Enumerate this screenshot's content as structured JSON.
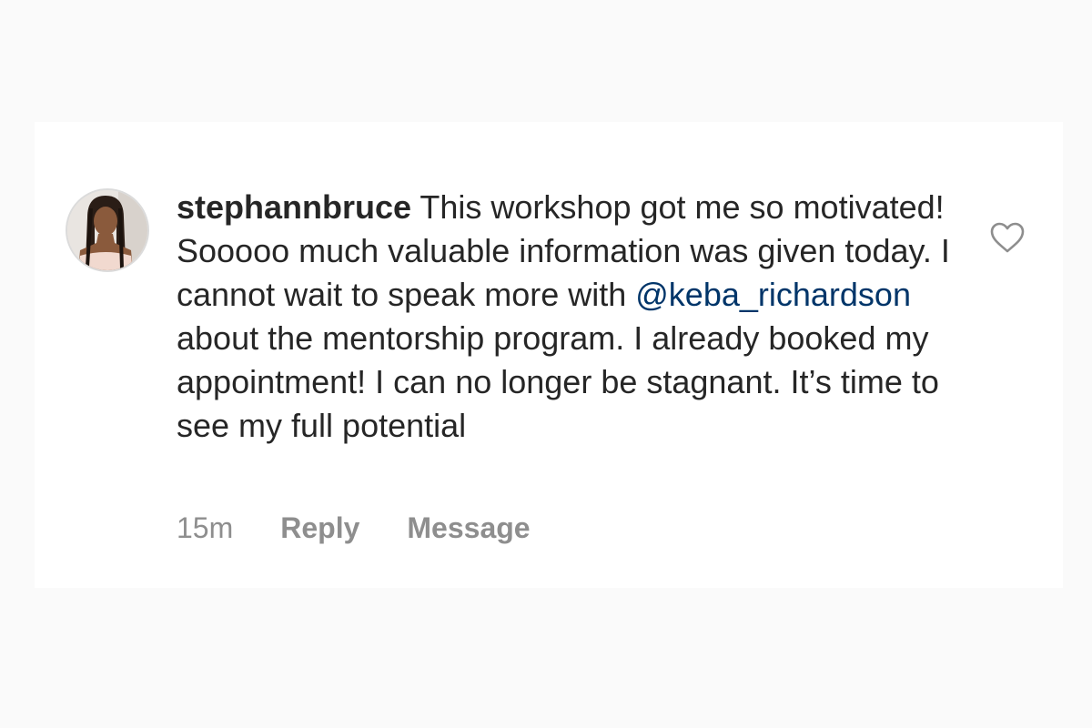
{
  "comment": {
    "username": "stephannbruce",
    "text_before_mention": " This workshop got me so motivated! Sooooo much valuable information was given today. I cannot wait to speak more with ",
    "mention": "@keba_richardson",
    "text_after_mention": " about the mentorship program. I already booked my appointment! I can no longer be stagnant. It’s time to see my full potential"
  },
  "meta": {
    "timestamp": "15m",
    "reply_label": "Reply",
    "message_label": "Message"
  },
  "icons": {
    "like": "heart-outline-icon",
    "avatar": "profile-photo"
  },
  "colors": {
    "mention": "#003569",
    "meta_text": "#8e8e8e",
    "body_text": "#262626"
  }
}
